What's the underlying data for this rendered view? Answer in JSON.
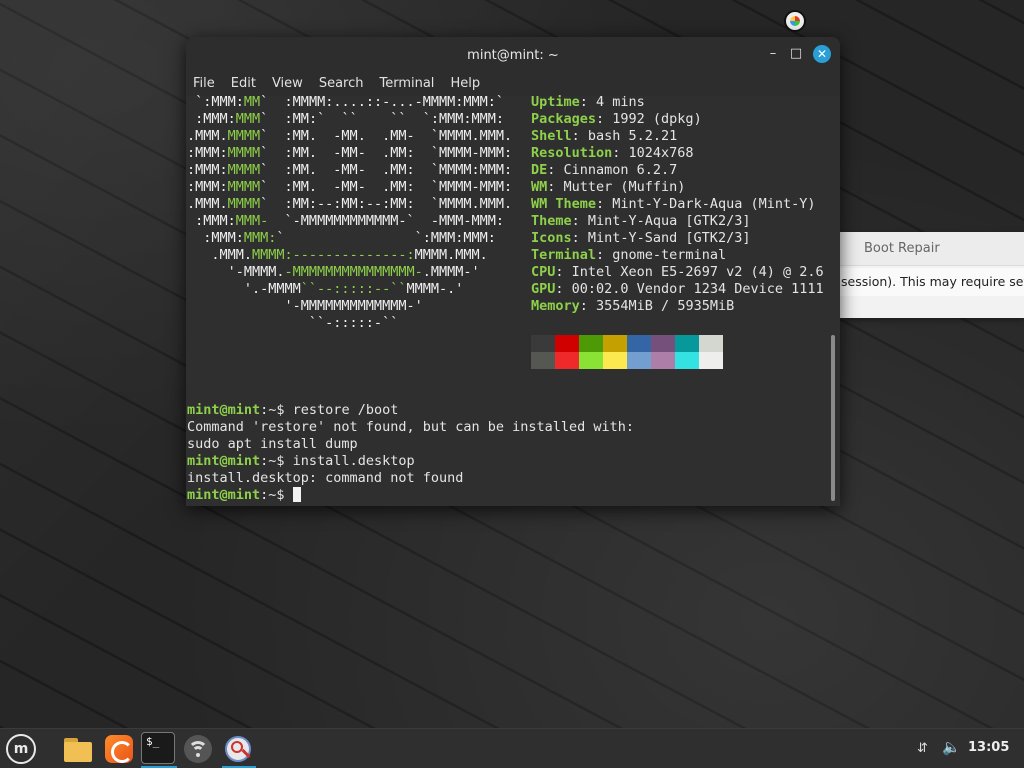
{
  "terminal": {
    "title": "mint@mint: ~",
    "menu": [
      "File",
      "Edit",
      "View",
      "Search",
      "Terminal",
      "Help"
    ],
    "ascii_art": [
      [
        {
          "t": " `:MMM:",
          "c": ""
        },
        {
          "t": "MM",
          "c": "g"
        },
        {
          "t": "`  :MMMM:....::-...-MMMM:MMM:`",
          "c": ""
        }
      ],
      [
        {
          "t": " :MMM:",
          "c": ""
        },
        {
          "t": "MMM",
          "c": "g"
        },
        {
          "t": "`  :MM:`  ``    ``  `:MMM:MMM:",
          "c": ""
        }
      ],
      [
        {
          "t": ".MMM.",
          "c": ""
        },
        {
          "t": "MMMM",
          "c": "g"
        },
        {
          "t": "`  :MM.  -MM.  .MM-  `MMMM.MMM.",
          "c": ""
        }
      ],
      [
        {
          "t": ":MMM:",
          "c": ""
        },
        {
          "t": "MMMM",
          "c": "g"
        },
        {
          "t": "`  :MM.  -MM-  .MM:  `MMMM-MMM:",
          "c": ""
        }
      ],
      [
        {
          "t": ":MMM:",
          "c": ""
        },
        {
          "t": "MMMM",
          "c": "g"
        },
        {
          "t": "`  :MM.  -MM-  .MM:  `MMMM:MMM:",
          "c": ""
        }
      ],
      [
        {
          "t": ":MMM:",
          "c": ""
        },
        {
          "t": "MMMM",
          "c": "g"
        },
        {
          "t": "`  :MM.  -MM-  .MM:  `MMMM-MMM:",
          "c": ""
        }
      ],
      [
        {
          "t": ".MMM.",
          "c": ""
        },
        {
          "t": "MMMM",
          "c": "g"
        },
        {
          "t": "`  :MM:--:MM:--:MM:  `MMMM.MMM.",
          "c": ""
        }
      ],
      [
        {
          "t": " :MMM:",
          "c": ""
        },
        {
          "t": "MMM-",
          "c": "g"
        },
        {
          "t": "  `-MMMMMMMMMMMM-`  -MMM-MMM:",
          "c": ""
        }
      ],
      [
        {
          "t": "  :MMM:",
          "c": ""
        },
        {
          "t": "MMM:",
          "c": "g"
        },
        {
          "t": "`                `:MMM:MMM:",
          "c": ""
        }
      ],
      [
        {
          "t": "   .MMM.",
          "c": ""
        },
        {
          "t": "MMMM:--------------:",
          "c": "g"
        },
        {
          "t": "MMMM.MMM.",
          "c": ""
        }
      ],
      [
        {
          "t": "     '-MMMM.",
          "c": ""
        },
        {
          "t": "-MMMMMMMMMMMMMMM-",
          "c": "g"
        },
        {
          "t": ".MMMM-'",
          "c": ""
        }
      ],
      [
        {
          "t": "       '.-MMMM",
          "c": ""
        },
        {
          "t": "``--:::::--``",
          "c": "g"
        },
        {
          "t": "MMMM-.'",
          "c": ""
        }
      ],
      [
        {
          "t": "            '-MMMMMMMMMMMMM-'",
          "c": ""
        }
      ],
      [
        {
          "t": "               ``-:::::-``",
          "c": ""
        }
      ]
    ],
    "info": [
      {
        "key": "Uptime",
        "value": "4 mins"
      },
      {
        "key": "Packages",
        "value": "1992 (dpkg)"
      },
      {
        "key": "Shell",
        "value": "bash 5.2.21"
      },
      {
        "key": "Resolution",
        "value": "1024x768"
      },
      {
        "key": "DE",
        "value": "Cinnamon 6.2.7"
      },
      {
        "key": "WM",
        "value": "Mutter (Muffin)"
      },
      {
        "key": "WM Theme",
        "value": "Mint-Y-Dark-Aqua (Mint-Y)"
      },
      {
        "key": "Theme",
        "value": "Mint-Y-Aqua [GTK2/3]"
      },
      {
        "key": "Icons",
        "value": "Mint-Y-Sand [GTK2/3]"
      },
      {
        "key": "Terminal",
        "value": "gnome-terminal"
      },
      {
        "key": "CPU",
        "value": "Intel Xeon E5-2697 v2 (4) @ 2.6"
      },
      {
        "key": "GPU",
        "value": "00:02.0 Vendor 1234 Device 1111"
      },
      {
        "key": "Memory",
        "value": "3554MiB / 5935MiB"
      }
    ],
    "palette_row1": [
      "#3a3a3a",
      "#d00000",
      "#4e9a06",
      "#c4a000",
      "#3465a4",
      "#75507b",
      "#06989a",
      "#d3d7cf"
    ],
    "palette_row2": [
      "#555753",
      "#ef2929",
      "#8ae234",
      "#fce94f",
      "#729fcf",
      "#ad7fa8",
      "#34e2e2",
      "#eeeeec"
    ],
    "prompt_user": "mint@mint",
    "prompt_path": ":~$ ",
    "session": [
      {
        "type": "prompt",
        "cmd": "restore /boot"
      },
      {
        "type": "out",
        "text": "Command 'restore' not found, but can be installed with:"
      },
      {
        "type": "out",
        "text": "sudo apt install dump"
      },
      {
        "type": "prompt",
        "cmd": "install.desktop"
      },
      {
        "type": "out",
        "text": "install.desktop: command not found"
      },
      {
        "type": "prompt",
        "cmd": "",
        "cursor": true
      }
    ]
  },
  "bootrepair_window": {
    "title": "Boot Repair",
    "text": "session). This may require seve"
  },
  "taskbar": {
    "menu_icon": "mint-logo-icon",
    "launchers": [
      "folder-icon",
      "firefox-icon",
      "terminal-icon",
      "network-icon",
      "boot-repair-icon"
    ],
    "terminal_label": "$_",
    "clock": "13:05"
  }
}
